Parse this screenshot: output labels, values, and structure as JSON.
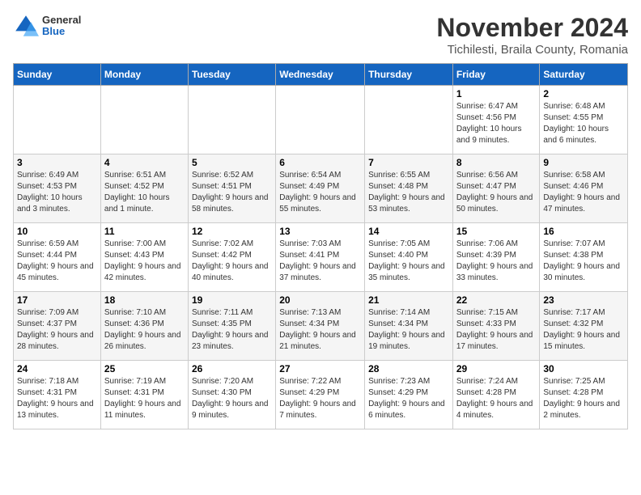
{
  "header": {
    "logo_general": "General",
    "logo_blue": "Blue",
    "month_title": "November 2024",
    "location": "Tichilesti, Braila County, Romania"
  },
  "weekdays": [
    "Sunday",
    "Monday",
    "Tuesday",
    "Wednesday",
    "Thursday",
    "Friday",
    "Saturday"
  ],
  "weeks": [
    [
      {
        "day": "",
        "info": ""
      },
      {
        "day": "",
        "info": ""
      },
      {
        "day": "",
        "info": ""
      },
      {
        "day": "",
        "info": ""
      },
      {
        "day": "",
        "info": ""
      },
      {
        "day": "1",
        "info": "Sunrise: 6:47 AM\nSunset: 4:56 PM\nDaylight: 10 hours and 9 minutes."
      },
      {
        "day": "2",
        "info": "Sunrise: 6:48 AM\nSunset: 4:55 PM\nDaylight: 10 hours and 6 minutes."
      }
    ],
    [
      {
        "day": "3",
        "info": "Sunrise: 6:49 AM\nSunset: 4:53 PM\nDaylight: 10 hours and 3 minutes."
      },
      {
        "day": "4",
        "info": "Sunrise: 6:51 AM\nSunset: 4:52 PM\nDaylight: 10 hours and 1 minute."
      },
      {
        "day": "5",
        "info": "Sunrise: 6:52 AM\nSunset: 4:51 PM\nDaylight: 9 hours and 58 minutes."
      },
      {
        "day": "6",
        "info": "Sunrise: 6:54 AM\nSunset: 4:49 PM\nDaylight: 9 hours and 55 minutes."
      },
      {
        "day": "7",
        "info": "Sunrise: 6:55 AM\nSunset: 4:48 PM\nDaylight: 9 hours and 53 minutes."
      },
      {
        "day": "8",
        "info": "Sunrise: 6:56 AM\nSunset: 4:47 PM\nDaylight: 9 hours and 50 minutes."
      },
      {
        "day": "9",
        "info": "Sunrise: 6:58 AM\nSunset: 4:46 PM\nDaylight: 9 hours and 47 minutes."
      }
    ],
    [
      {
        "day": "10",
        "info": "Sunrise: 6:59 AM\nSunset: 4:44 PM\nDaylight: 9 hours and 45 minutes."
      },
      {
        "day": "11",
        "info": "Sunrise: 7:00 AM\nSunset: 4:43 PM\nDaylight: 9 hours and 42 minutes."
      },
      {
        "day": "12",
        "info": "Sunrise: 7:02 AM\nSunset: 4:42 PM\nDaylight: 9 hours and 40 minutes."
      },
      {
        "day": "13",
        "info": "Sunrise: 7:03 AM\nSunset: 4:41 PM\nDaylight: 9 hours and 37 minutes."
      },
      {
        "day": "14",
        "info": "Sunrise: 7:05 AM\nSunset: 4:40 PM\nDaylight: 9 hours and 35 minutes."
      },
      {
        "day": "15",
        "info": "Sunrise: 7:06 AM\nSunset: 4:39 PM\nDaylight: 9 hours and 33 minutes."
      },
      {
        "day": "16",
        "info": "Sunrise: 7:07 AM\nSunset: 4:38 PM\nDaylight: 9 hours and 30 minutes."
      }
    ],
    [
      {
        "day": "17",
        "info": "Sunrise: 7:09 AM\nSunset: 4:37 PM\nDaylight: 9 hours and 28 minutes."
      },
      {
        "day": "18",
        "info": "Sunrise: 7:10 AM\nSunset: 4:36 PM\nDaylight: 9 hours and 26 minutes."
      },
      {
        "day": "19",
        "info": "Sunrise: 7:11 AM\nSunset: 4:35 PM\nDaylight: 9 hours and 23 minutes."
      },
      {
        "day": "20",
        "info": "Sunrise: 7:13 AM\nSunset: 4:34 PM\nDaylight: 9 hours and 21 minutes."
      },
      {
        "day": "21",
        "info": "Sunrise: 7:14 AM\nSunset: 4:34 PM\nDaylight: 9 hours and 19 minutes."
      },
      {
        "day": "22",
        "info": "Sunrise: 7:15 AM\nSunset: 4:33 PM\nDaylight: 9 hours and 17 minutes."
      },
      {
        "day": "23",
        "info": "Sunrise: 7:17 AM\nSunset: 4:32 PM\nDaylight: 9 hours and 15 minutes."
      }
    ],
    [
      {
        "day": "24",
        "info": "Sunrise: 7:18 AM\nSunset: 4:31 PM\nDaylight: 9 hours and 13 minutes."
      },
      {
        "day": "25",
        "info": "Sunrise: 7:19 AM\nSunset: 4:31 PM\nDaylight: 9 hours and 11 minutes."
      },
      {
        "day": "26",
        "info": "Sunrise: 7:20 AM\nSunset: 4:30 PM\nDaylight: 9 hours and 9 minutes."
      },
      {
        "day": "27",
        "info": "Sunrise: 7:22 AM\nSunset: 4:29 PM\nDaylight: 9 hours and 7 minutes."
      },
      {
        "day": "28",
        "info": "Sunrise: 7:23 AM\nSunset: 4:29 PM\nDaylight: 9 hours and 6 minutes."
      },
      {
        "day": "29",
        "info": "Sunrise: 7:24 AM\nSunset: 4:28 PM\nDaylight: 9 hours and 4 minutes."
      },
      {
        "day": "30",
        "info": "Sunrise: 7:25 AM\nSunset: 4:28 PM\nDaylight: 9 hours and 2 minutes."
      }
    ]
  ]
}
